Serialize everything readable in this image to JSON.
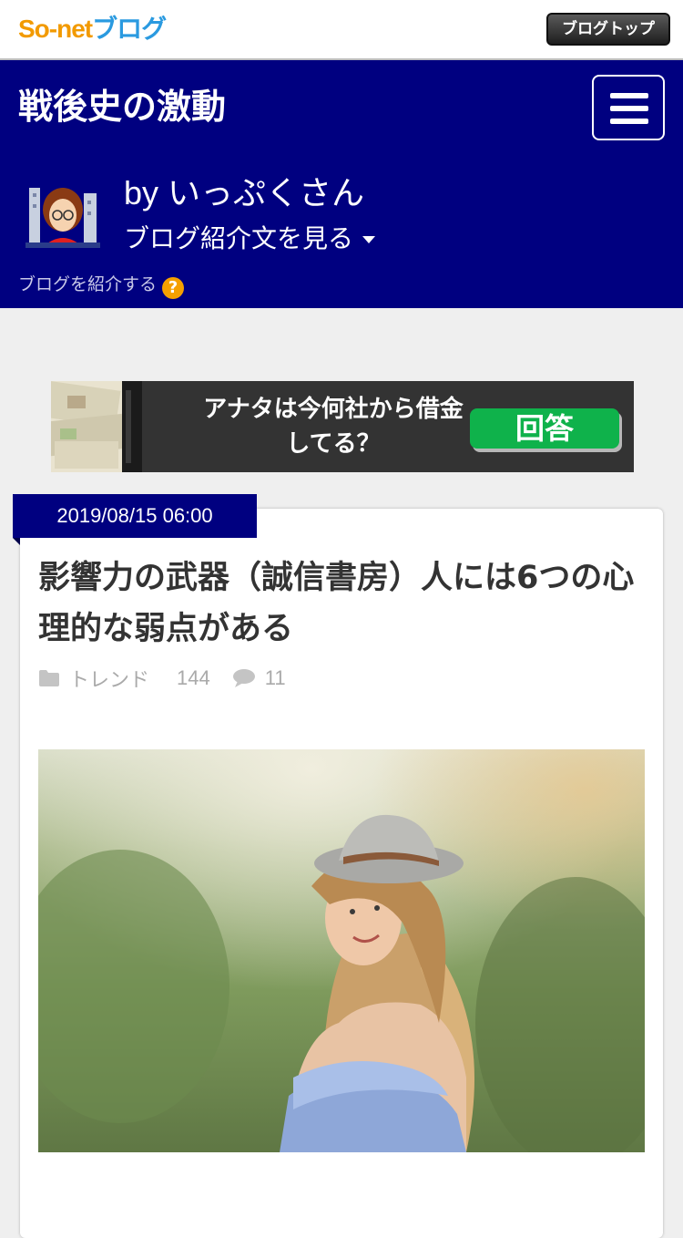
{
  "topbar": {
    "logo_so": "So-net",
    "logo_blog": "ブログ",
    "blog_top_label": "ブログトップ"
  },
  "header": {
    "title": "戦後史の激動",
    "byline": "by いっぷくさん",
    "intro_link": "ブログ紹介文を見る",
    "introduce_label": "ブログを紹介する",
    "help_glyph": "?"
  },
  "ad": {
    "text": "アナタは今何社から借金してる？",
    "button_label": "回答"
  },
  "post": {
    "date": "2019/08/15 06:00",
    "title": "影響力の武器（誠信書房）人には6つの心理的な弱点がある",
    "category": "トレンド",
    "views": "144",
    "comments": "11"
  },
  "colors": {
    "header_bg": "#000080",
    "accent_orange": "#f5a000",
    "ad_button": "#0fb24b"
  },
  "icons": [
    "menu-icon",
    "chevron-down-icon",
    "help-icon",
    "folder-icon",
    "comment-icon"
  ]
}
